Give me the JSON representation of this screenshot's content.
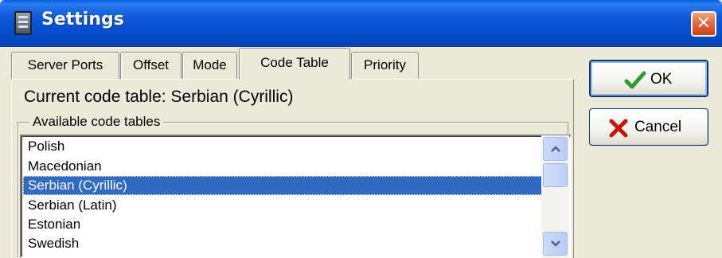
{
  "window": {
    "title": "Settings",
    "app_icon": "device-icon",
    "close_icon": "close-icon",
    "close_glyph": "✕"
  },
  "tabs": [
    {
      "label": "Server Ports"
    },
    {
      "label": "Offset"
    },
    {
      "label": "Mode"
    },
    {
      "label": "Code Table",
      "active": true
    },
    {
      "label": "Priority"
    }
  ],
  "panel": {
    "current_label": "Current code table: Serbian (Cyrillic)",
    "group_label": "Available code tables",
    "list_items": [
      "Polish",
      "Macedonian",
      "Serbian (Cyrillic)",
      "Serbian (Latin)",
      "Estonian",
      "Swedish"
    ],
    "selected_item": "Serbian (Cyrillic)"
  },
  "buttons": {
    "ok_label": "OK",
    "ok_icon": "checkmark-icon",
    "cancel_label": "Cancel",
    "cancel_icon": "x-mark-icon"
  },
  "colors": {
    "titlebar": "#0550d0",
    "selection": "#316ac5",
    "close_button": "#e36a3e",
    "ok_check": "#2f9a2a",
    "cancel_x": "#c8140a"
  }
}
